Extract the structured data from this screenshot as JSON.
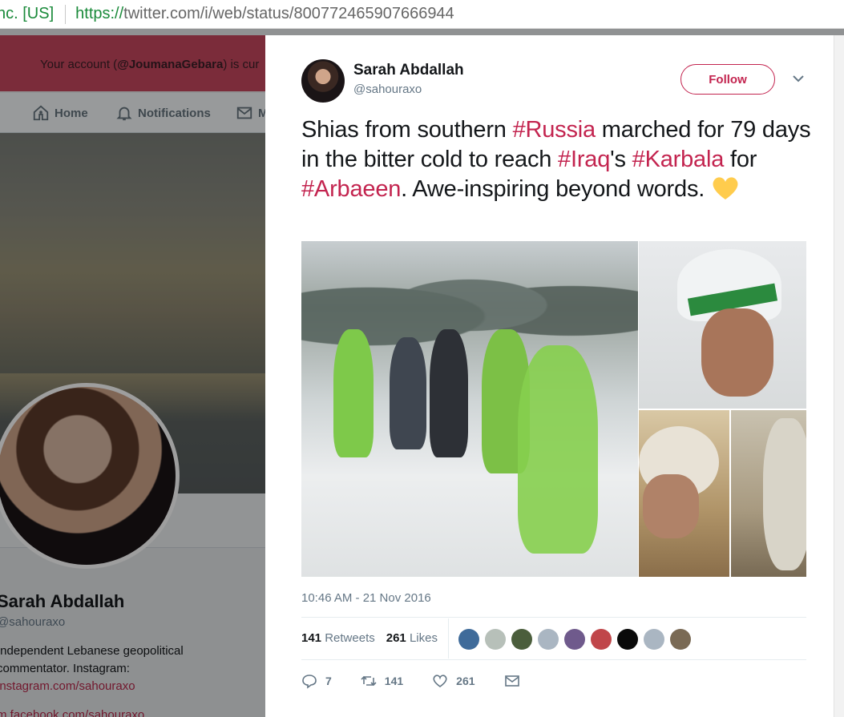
{
  "address_bar": {
    "cert": "nc. [US]",
    "url_scheme": "https://",
    "url_rest": "twitter.com/i/web/status/800772465907666944"
  },
  "background_page": {
    "banner_text_prefix": "Your account (",
    "banner_handle": "@JoumanaGebara",
    "banner_text_suffix": ") is cur",
    "nav": {
      "home": "Home",
      "notifications": "Notifications",
      "messages": "M"
    },
    "profile": {
      "name": "Sarah Abdallah",
      "handle": "@sahouraxo",
      "bio": "Independent Lebanese geopolitical commentator. Instagram:",
      "link": "instagram.com/sahouraxo",
      "link2": "m.facebook.com/sahouraxo"
    }
  },
  "tweet": {
    "author_name": "Sarah Abdallah",
    "author_handle": "@sahouraxo",
    "follow_label": "Follow",
    "text": {
      "p1": "Shias from southern ",
      "tag_russia": "#Russia",
      "p2": " marched for 79 days in the bitter cold to reach ",
      "tag_iraq": "#Iraq",
      "p3": "'s ",
      "tag_karbala": "#Karbala",
      "p4": " for ",
      "tag_arbaeen": "#Arbaeen",
      "p5": ". Awe-inspiring beyond words."
    },
    "emoji": "yellow-heart",
    "timestamp": "10:46 AM - 21 Nov 2016",
    "retweets_count": "141",
    "retweets_label": "Retweets",
    "likes_count": "261",
    "likes_label": "Likes",
    "actions": {
      "reply_count": "7",
      "retweet_count": "141",
      "like_count": "261"
    },
    "likers": [
      "#3f6b9a",
      "#b7c0b9",
      "#4b5e3c",
      "#aab6c2",
      "#6f5a8c",
      "#c0464a",
      "#0a0a0a",
      "#aab6c2",
      "#7a6a55"
    ]
  },
  "colors": {
    "accent": "#c3244f",
    "banner": "#c7475e"
  }
}
